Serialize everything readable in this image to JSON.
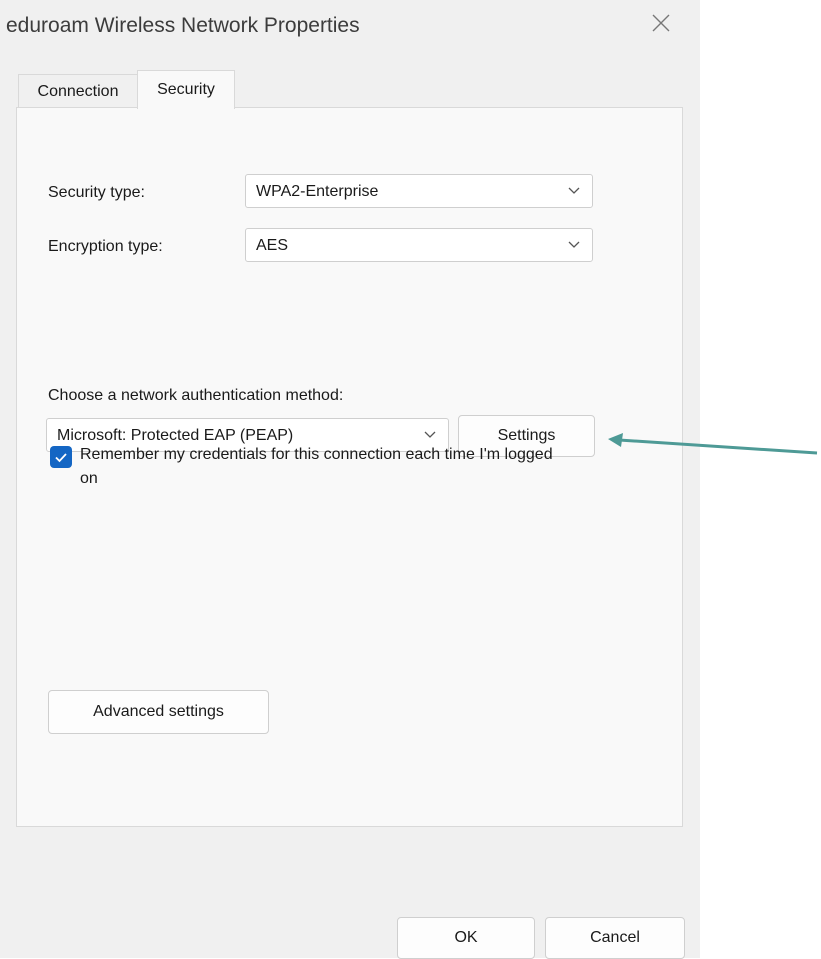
{
  "window": {
    "title": "eduroam Wireless Network Properties"
  },
  "tabs": [
    {
      "label": "Connection"
    },
    {
      "label": "Security"
    }
  ],
  "security": {
    "security_type_label": "Security type:",
    "security_type_value": "WPA2-Enterprise",
    "encryption_type_label": "Encryption type:",
    "encryption_type_value": "AES",
    "auth_method_label": "Choose a network authentication method:",
    "auth_method_value": "Microsoft: Protected EAP (PEAP)",
    "settings_button": "Settings",
    "remember_label": "Remember my credentials for this connection each time I'm logged on",
    "remember_checked": true,
    "advanced_button": "Advanced settings"
  },
  "footer": {
    "ok": "OK",
    "cancel": "Cancel"
  },
  "colors": {
    "accent": "#1466c4",
    "annotation_arrow": "#4e9a96"
  },
  "icons": {
    "close": "close-icon",
    "dropdown": "chevron-down-icon",
    "check": "checkmark-icon",
    "annotation": "arrow-left-icon"
  }
}
